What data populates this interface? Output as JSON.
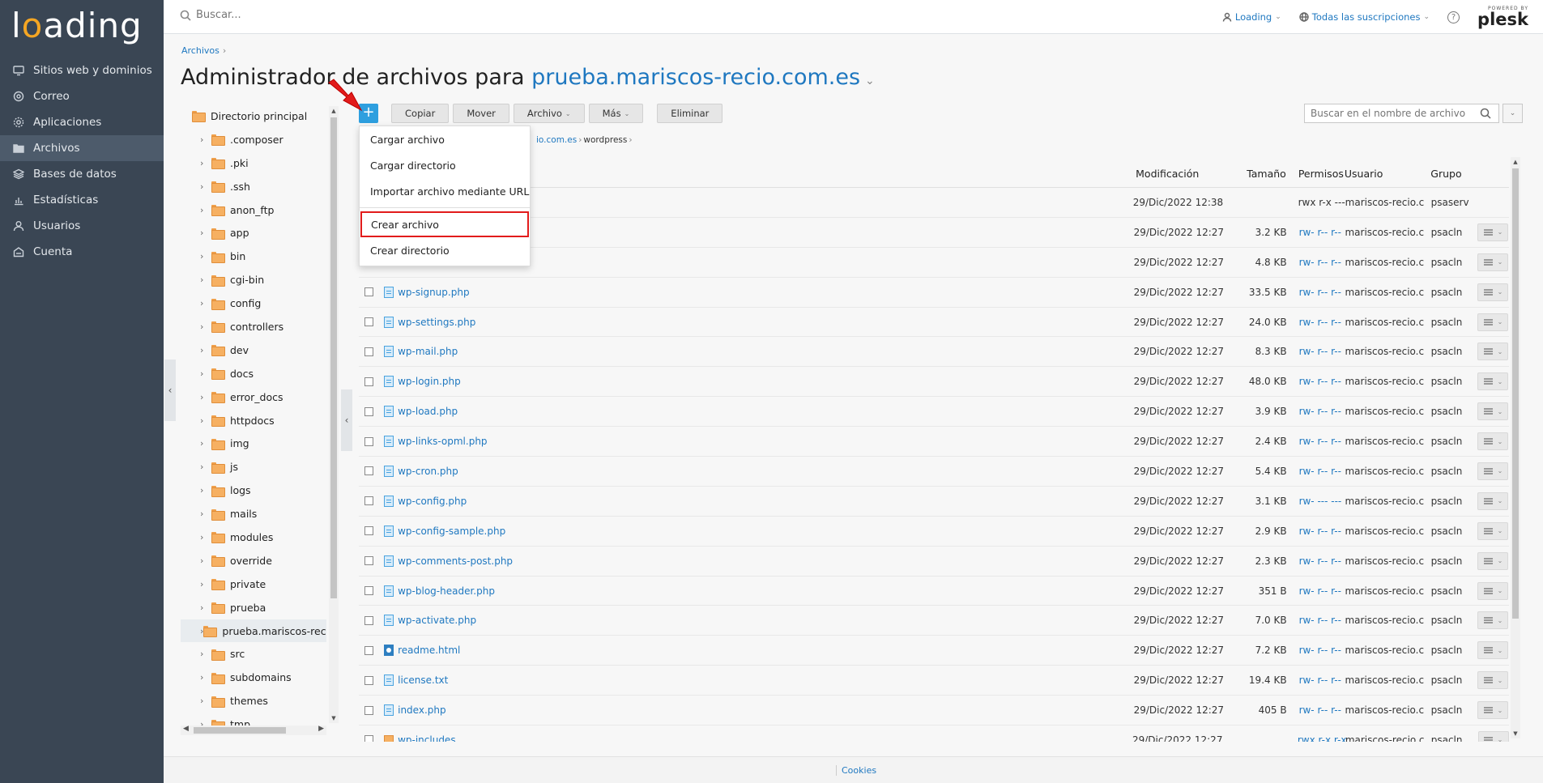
{
  "logo": "loading",
  "sidebar": {
    "items": [
      {
        "label": "Sitios web y dominios",
        "icon": "monitor-icon"
      },
      {
        "label": "Correo",
        "icon": "mail-icon"
      },
      {
        "label": "Aplicaciones",
        "icon": "gear-icon"
      },
      {
        "label": "Archivos",
        "icon": "folder-icon",
        "active": true
      },
      {
        "label": "Bases de datos",
        "icon": "database-icon"
      },
      {
        "label": "Estadísticas",
        "icon": "chart-icon"
      },
      {
        "label": "Usuarios",
        "icon": "user-icon"
      },
      {
        "label": "Cuenta",
        "icon": "account-icon"
      }
    ]
  },
  "header": {
    "search_placeholder": "Buscar...",
    "user_label": "Loading",
    "subscriptions_label": "Todas las suscripciones",
    "powered_by": "POWERED BY",
    "brand": "plesk"
  },
  "breadcrumb": {
    "item": "Archivos"
  },
  "title": {
    "prefix": "Administrador de archivos para",
    "domain": "prueba.mariscos-recio.com.es"
  },
  "tree": {
    "root": "Directorio principal",
    "items": [
      ".composer",
      ".pki",
      ".ssh",
      "anon_ftp",
      "app",
      "bin",
      "cgi-bin",
      "config",
      "controllers",
      "dev",
      "docs",
      "error_docs",
      "httpdocs",
      "img",
      "js",
      "logs",
      "mails",
      "modules",
      "override",
      "private",
      "prueba",
      "prueba.mariscos-recio.com.es",
      "src",
      "subdomains",
      "themes",
      "tmp"
    ]
  },
  "toolbar": {
    "add_label": "+",
    "copy_label": "Copiar",
    "move_label": "Mover",
    "file_label": "Archivo",
    "more_label": "Más",
    "delete_label": "Eliminar",
    "search_placeholder": "Buscar en el nombre de archivo"
  },
  "path": {
    "parent": "io.com.es",
    "current": "wordpress"
  },
  "dropdown": {
    "items": [
      "Cargar archivo",
      "Cargar directorio",
      "Importar archivo mediante URL",
      "Crear archivo",
      "Crear directorio"
    ],
    "highlighted": "Crear archivo",
    "highlight_color": "#e21b1b"
  },
  "table": {
    "headers": {
      "modified": "Modificación",
      "size": "Tamaño",
      "perms": "Permisos",
      "user": "Usuario",
      "group": "Grupo"
    },
    "rows": [
      {
        "name": "",
        "modified": "29/Dic/2022 12:38",
        "size": "",
        "perms": "rwx r-x ---",
        "user": "mariscos-recio.c",
        "group": "psaserv",
        "type": "parent"
      },
      {
        "name": "",
        "modified": "29/Dic/2022 12:27",
        "size": "3.2 KB",
        "perms": "rw- r-- r--",
        "user": "mariscos-recio.c",
        "group": "psacln",
        "type": "hidden"
      },
      {
        "name": "",
        "modified": "29/Dic/2022 12:27",
        "size": "4.8 KB",
        "perms": "rw- r-- r--",
        "user": "mariscos-recio.c",
        "group": "psacln",
        "type": "hidden"
      },
      {
        "name": "wp-signup.php",
        "modified": "29/Dic/2022 12:27",
        "size": "33.5 KB",
        "perms": "rw- r-- r--",
        "user": "mariscos-recio.c",
        "group": "psacln",
        "type": "file"
      },
      {
        "name": "wp-settings.php",
        "modified": "29/Dic/2022 12:27",
        "size": "24.0 KB",
        "perms": "rw- r-- r--",
        "user": "mariscos-recio.c",
        "group": "psacln",
        "type": "file"
      },
      {
        "name": "wp-mail.php",
        "modified": "29/Dic/2022 12:27",
        "size": "8.3 KB",
        "perms": "rw- r-- r--",
        "user": "mariscos-recio.c",
        "group": "psacln",
        "type": "file"
      },
      {
        "name": "wp-login.php",
        "modified": "29/Dic/2022 12:27",
        "size": "48.0 KB",
        "perms": "rw- r-- r--",
        "user": "mariscos-recio.c",
        "group": "psacln",
        "type": "file"
      },
      {
        "name": "wp-load.php",
        "modified": "29/Dic/2022 12:27",
        "size": "3.9 KB",
        "perms": "rw- r-- r--",
        "user": "mariscos-recio.c",
        "group": "psacln",
        "type": "file"
      },
      {
        "name": "wp-links-opml.php",
        "modified": "29/Dic/2022 12:27",
        "size": "2.4 KB",
        "perms": "rw- r-- r--",
        "user": "mariscos-recio.c",
        "group": "psacln",
        "type": "file"
      },
      {
        "name": "wp-cron.php",
        "modified": "29/Dic/2022 12:27",
        "size": "5.4 KB",
        "perms": "rw- r-- r--",
        "user": "mariscos-recio.c",
        "group": "psacln",
        "type": "file"
      },
      {
        "name": "wp-config.php",
        "modified": "29/Dic/2022 12:27",
        "size": "3.1 KB",
        "perms": "rw- --- ---",
        "user": "mariscos-recio.c",
        "group": "psacln",
        "type": "file"
      },
      {
        "name": "wp-config-sample.php",
        "modified": "29/Dic/2022 12:27",
        "size": "2.9 KB",
        "perms": "rw- r-- r--",
        "user": "mariscos-recio.c",
        "group": "psacln",
        "type": "file"
      },
      {
        "name": "wp-comments-post.php",
        "modified": "29/Dic/2022 12:27",
        "size": "2.3 KB",
        "perms": "rw- r-- r--",
        "user": "mariscos-recio.c",
        "group": "psacln",
        "type": "file"
      },
      {
        "name": "wp-blog-header.php",
        "modified": "29/Dic/2022 12:27",
        "size": "351 B",
        "perms": "rw- r-- r--",
        "user": "mariscos-recio.c",
        "group": "psacln",
        "type": "file"
      },
      {
        "name": "wp-activate.php",
        "modified": "29/Dic/2022 12:27",
        "size": "7.0 KB",
        "perms": "rw- r-- r--",
        "user": "mariscos-recio.c",
        "group": "psacln",
        "type": "file"
      },
      {
        "name": "readme.html",
        "modified": "29/Dic/2022 12:27",
        "size": "7.2 KB",
        "perms": "rw- r-- r--",
        "user": "mariscos-recio.c",
        "group": "psacln",
        "type": "html"
      },
      {
        "name": "license.txt",
        "modified": "29/Dic/2022 12:27",
        "size": "19.4 KB",
        "perms": "rw- r-- r--",
        "user": "mariscos-recio.c",
        "group": "psacln",
        "type": "file"
      },
      {
        "name": "index.php",
        "modified": "29/Dic/2022 12:27",
        "size": "405 B",
        "perms": "rw- r-- r--",
        "user": "mariscos-recio.c",
        "group": "psacln",
        "type": "file"
      },
      {
        "name": "wp-includes",
        "modified": "29/Dic/2022 12:27",
        "size": "",
        "perms": "rwx r-x r-x",
        "user": "mariscos-recio.c",
        "group": "psacln",
        "type": "folder"
      }
    ]
  },
  "footer": {
    "cookies": "Cookies"
  },
  "colors": {
    "sidebar": "#3a4654",
    "accent": "#1f78c0",
    "add_button": "#2e9fdf",
    "folder": "#f6b062"
  }
}
